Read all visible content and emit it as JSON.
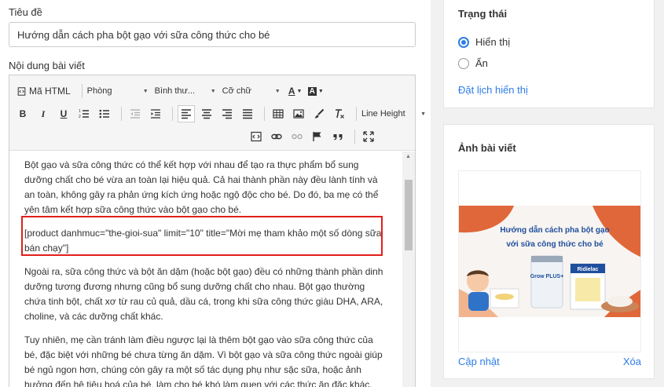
{
  "title_label": "Tiêu đề",
  "title_value": "Hướng dẫn cách pha bột gạo với sữa công thức cho bé",
  "content_label": "Nội dung bài viết",
  "toolbar": {
    "html_label": "Mã HTML",
    "paragraph_label": "Phòng",
    "format_label": "Bình thư...",
    "font_size_label": "Cỡ chữ",
    "text_color_label": "A",
    "bg_color_label": "A",
    "bold": "B",
    "italic": "I",
    "underline": "U",
    "line_height_label": "Line Height"
  },
  "content": {
    "p1": "Bột gạo và sữa công thức có thể kết hợp với nhau để tạo ra thực phẩm bổ sung dưỡng chất cho bé vừa an toàn lại hiệu quả. Cả hai thành phần này đều lành tính và an toàn, không gây ra phản ứng kích ứng hoặc ngộ độc cho bé. Do đó, ba mẹ có thể yên tâm kết hợp sữa công thức vào bột gạo cho bé.",
    "p2": "[product danhmuc=\"the-gioi-sua\" limit=\"10\" title=\"Mời mẹ tham khảo một số dòng sữa bán chạy\"]",
    "p3": "Ngoài ra, sữa công thức và bột ăn dặm (hoặc bột gạo) đều có những thành phần dinh dưỡng tương đương nhưng cũng bổ sung dưỡng chất cho nhau. Bột gạo thường chứa tinh bột, chất xơ từ rau củ quả, dầu cá, trong khi sữa công thức giàu DHA, ARA, choline, và các dưỡng chất khác.",
    "p4": "Tuy nhiên, mẹ cần tránh làm điều ngược lại là thêm bột gạo vào sữa công thức của bé, đặc biệt với những bé chưa từng ăn dặm. Vì bột gạo và sữa công thức ngoài giúp bé ngủ ngon hơn, chúng còn gây ra một số tác dụng phụ như sặc sữa, hoặc ảnh hưởng đến hệ tiêu hoá của bé, làm cho bé khó làm quen với các thức ăn đặc khác."
  },
  "status": {
    "title": "Trạng thái",
    "option_show": "Hiển thị",
    "option_hide": "Ẩn",
    "selected": "Hiển thị",
    "schedule_link": "Đặt lịch hiển thị"
  },
  "featured": {
    "title": "Ảnh bài viết",
    "banner_text_line1": "Hướng dẫn cách pha bột gạo",
    "banner_text_line2": "với sữa công thức cho bé",
    "product1": "Grow PLUS+",
    "product2": "Ridielac",
    "update_link": "Cập nhật",
    "delete_link": "Xóa"
  },
  "colors": {
    "accent": "#2e7ce8",
    "highlight_border": "#e0201b",
    "banner_orange": "#e0673a",
    "banner_blue": "#1f4e9c"
  }
}
